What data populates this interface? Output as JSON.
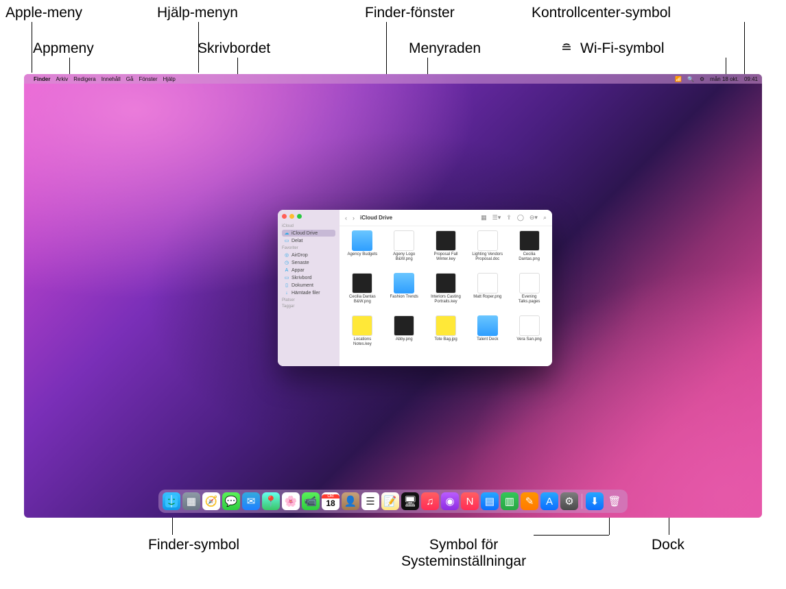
{
  "callouts": {
    "apple_menu": "Apple-meny",
    "app_menu": "Appmeny",
    "help_menu": "Hjälp-menyn",
    "desktop": "Skrivbordet",
    "finder_window": "Finder-fönster",
    "menubar": "Menyraden",
    "control_center": "Kontrollcenter-symbol",
    "wifi": "Wi-Fi-symbol",
    "finder_icon": "Finder-symbol",
    "sysprefs": "Symbol för\nSysteminställningar",
    "sysprefs_l1": "Symbol för",
    "sysprefs_l2": "Systeminställningar",
    "dock": "Dock"
  },
  "menubar": {
    "app": "Finder",
    "items": [
      "Arkiv",
      "Redigera",
      "Innehåll",
      "Gå",
      "Fönster",
      "Hjälp"
    ],
    "date": "mån 18 okt.",
    "time": "09:41"
  },
  "finder": {
    "title": "iCloud Drive",
    "sidebar": {
      "sec_icloud": "iCloud",
      "icloud_drive": "iCloud Drive",
      "shared": "Delat",
      "sec_fav": "Favoriter",
      "airdrop": "AirDrop",
      "recent": "Senaste",
      "apps": "Appar",
      "desktop": "Skrivbord",
      "documents": "Dokument",
      "downloads": "Hämtade filer",
      "sec_loc": "Platser",
      "sec_tags": "Taggar"
    },
    "files": [
      {
        "label": "Agency Budgets",
        "kind": "folder"
      },
      {
        "label": "Ageny Logo B&W.png",
        "kind": "doc"
      },
      {
        "label": "Proposal Fall Winter.key",
        "kind": "dark"
      },
      {
        "label": "Lighting Vendors Proposal.doc",
        "kind": "doc"
      },
      {
        "label": "Cecilia Dantas.png",
        "kind": "dark"
      },
      {
        "label": "Cecilia Dantas B&W.png",
        "kind": "dark"
      },
      {
        "label": "Fashion Trends",
        "kind": "folder"
      },
      {
        "label": "Interiors Casting Portraits.key",
        "kind": "dark"
      },
      {
        "label": "Matt Roper.png",
        "kind": "doc"
      },
      {
        "label": "Evening Talks.pages",
        "kind": "doc"
      },
      {
        "label": "Locations Notes.key",
        "kind": "yellow"
      },
      {
        "label": "Abby.png",
        "kind": "dark"
      },
      {
        "label": "Tote Bag.jpg",
        "kind": "yellow"
      },
      {
        "label": "Talent Deck",
        "kind": "folder"
      },
      {
        "label": "Vera San.png",
        "kind": "doc"
      }
    ]
  },
  "dock": {
    "calendar_day": "18",
    "calendar_month": "Okt"
  }
}
